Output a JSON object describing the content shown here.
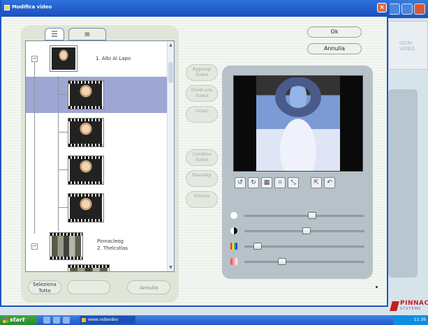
{
  "window": {
    "title": "Modifica video"
  },
  "actions": {
    "ok": "Ok",
    "cancel": "Annulla"
  },
  "tabs": {
    "tree_glyph": "☰",
    "list_glyph": "≡"
  },
  "tree": {
    "album_1_label": "1.  Albi Al Lapo",
    "album_2_label": "Pinnacleog\n2.  Thelcstlas"
  },
  "mid_buttons": [
    "Aggiungi Scena",
    "Dividi una Scena",
    "Unisci",
    "Combina Scene",
    "Riavvolgi",
    "Elimina"
  ],
  "left_panel_buttons": {
    "select_all": "Seleziona\nTutto",
    "blank": "",
    "right": "Annulla"
  },
  "background": {
    "right_panel_text": "ISCRI\nVIDEO",
    "logo": "PINNACLE",
    "logo_sub": "SYSTEMS"
  },
  "taskbar": {
    "start": "start",
    "task": "www.videodev",
    "tray": "11:39"
  },
  "sliders": [
    {
      "name": "brightness",
      "value": 0.57
    },
    {
      "name": "contrast",
      "value": 0.52
    },
    {
      "name": "color",
      "value": 0.08
    },
    {
      "name": "tint",
      "value": 0.3
    }
  ],
  "colors": {
    "accent": "#1d55c0",
    "selected_row": "#9ea6d4",
    "panel": "#b7c1c8"
  },
  "icons": [
    "rotate-left-icon",
    "rotate-right-icon",
    "grid-icon",
    "crop-icon",
    "resize-icon",
    "flip-icon",
    "undo-icon"
  ]
}
